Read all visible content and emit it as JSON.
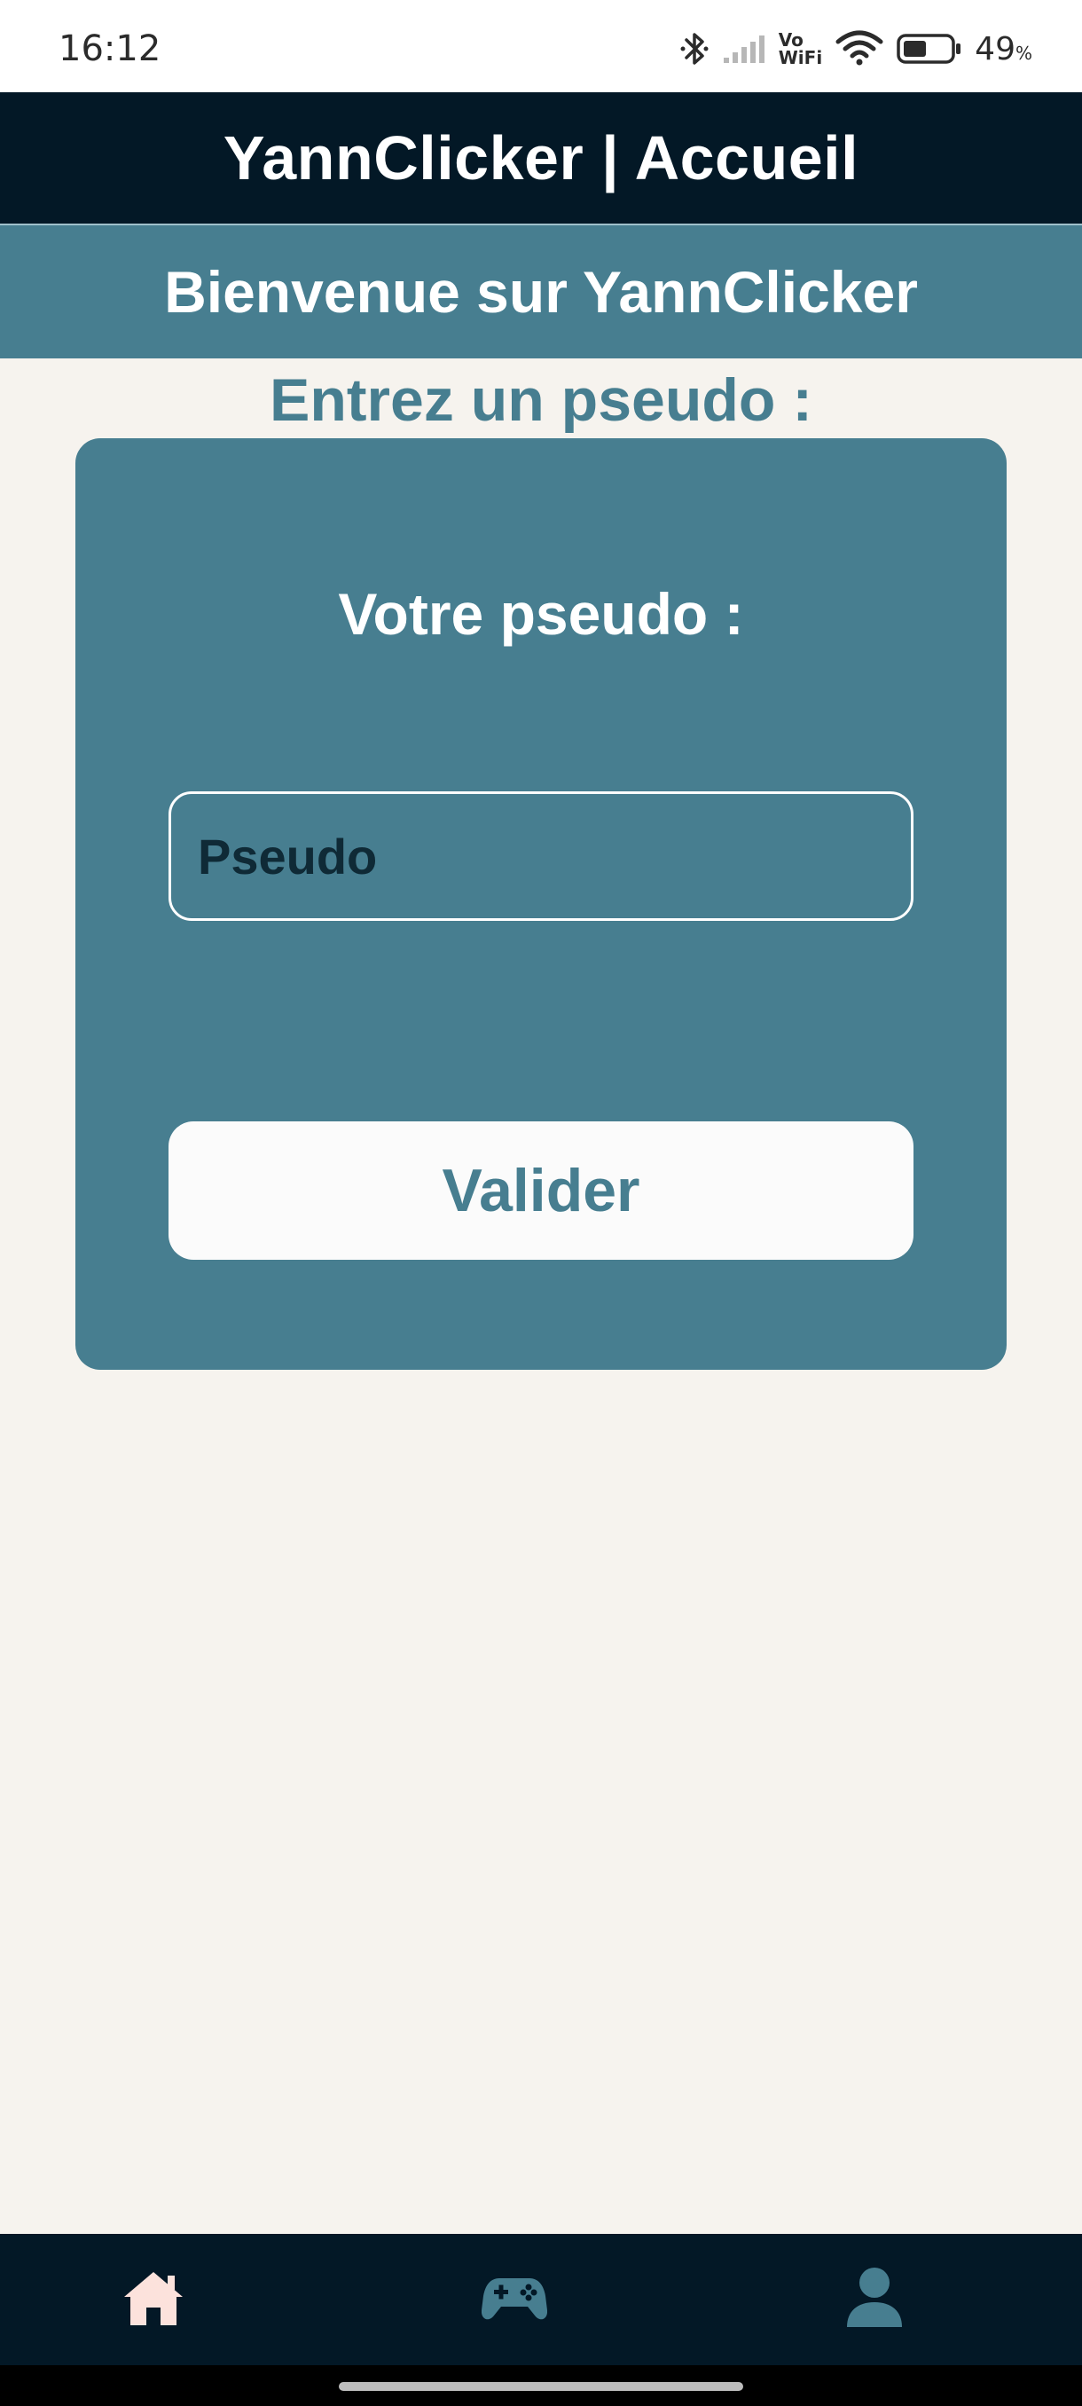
{
  "status_bar": {
    "time": "16:12",
    "vowifi_top": "Vo",
    "vowifi_bottom": "WiFi",
    "battery_percent": "49",
    "battery_unit": "%",
    "battery_level": 0.49,
    "icons": [
      "bluetooth-icon",
      "signal-icon",
      "vowifi-icon",
      "wifi-icon",
      "battery-icon"
    ]
  },
  "header": {
    "title": "YannClicker | Accueil"
  },
  "welcome": {
    "text": "Bienvenue sur YannClicker"
  },
  "prompt": {
    "text": "Entrez un pseudo :"
  },
  "card": {
    "title": "Votre pseudo :",
    "input_placeholder": "Pseudo",
    "input_value": "",
    "button_label": "Valider"
  },
  "bottom_nav": {
    "items": [
      {
        "icon": "home-icon",
        "active": true
      },
      {
        "icon": "gamepad-icon",
        "active": false
      },
      {
        "icon": "user-icon",
        "active": false
      }
    ]
  },
  "colors": {
    "header_bg": "#031826",
    "accent": "#477e90",
    "page_bg": "#f6f3ee",
    "active_nav_icon": "#fce2dc",
    "inactive_nav_icon": "#477e90"
  }
}
